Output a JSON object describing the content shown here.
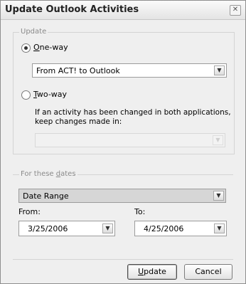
{
  "window": {
    "title": "Update Outlook Activities"
  },
  "update_group": {
    "legend": "Update",
    "one_way": {
      "label": "One-way",
      "selected": true
    },
    "direction_select": {
      "value": "From ACT! to Outlook"
    },
    "two_way": {
      "label": "Two-way",
      "selected": false
    },
    "conflict_text_line1": "If an activity has been changed in both applications,",
    "conflict_text_line2": "keep changes made in:"
  },
  "dates_group": {
    "legend": "For these dates",
    "range_select": {
      "value": "Date Range"
    },
    "from_label": "From:",
    "to_label": "To:",
    "from_value": "3/25/2006",
    "to_value": "4/25/2006"
  },
  "buttons": {
    "update": "Update",
    "cancel": "Cancel"
  },
  "icons": {
    "close": "close-icon",
    "dropdown": "chevron-down-icon"
  }
}
